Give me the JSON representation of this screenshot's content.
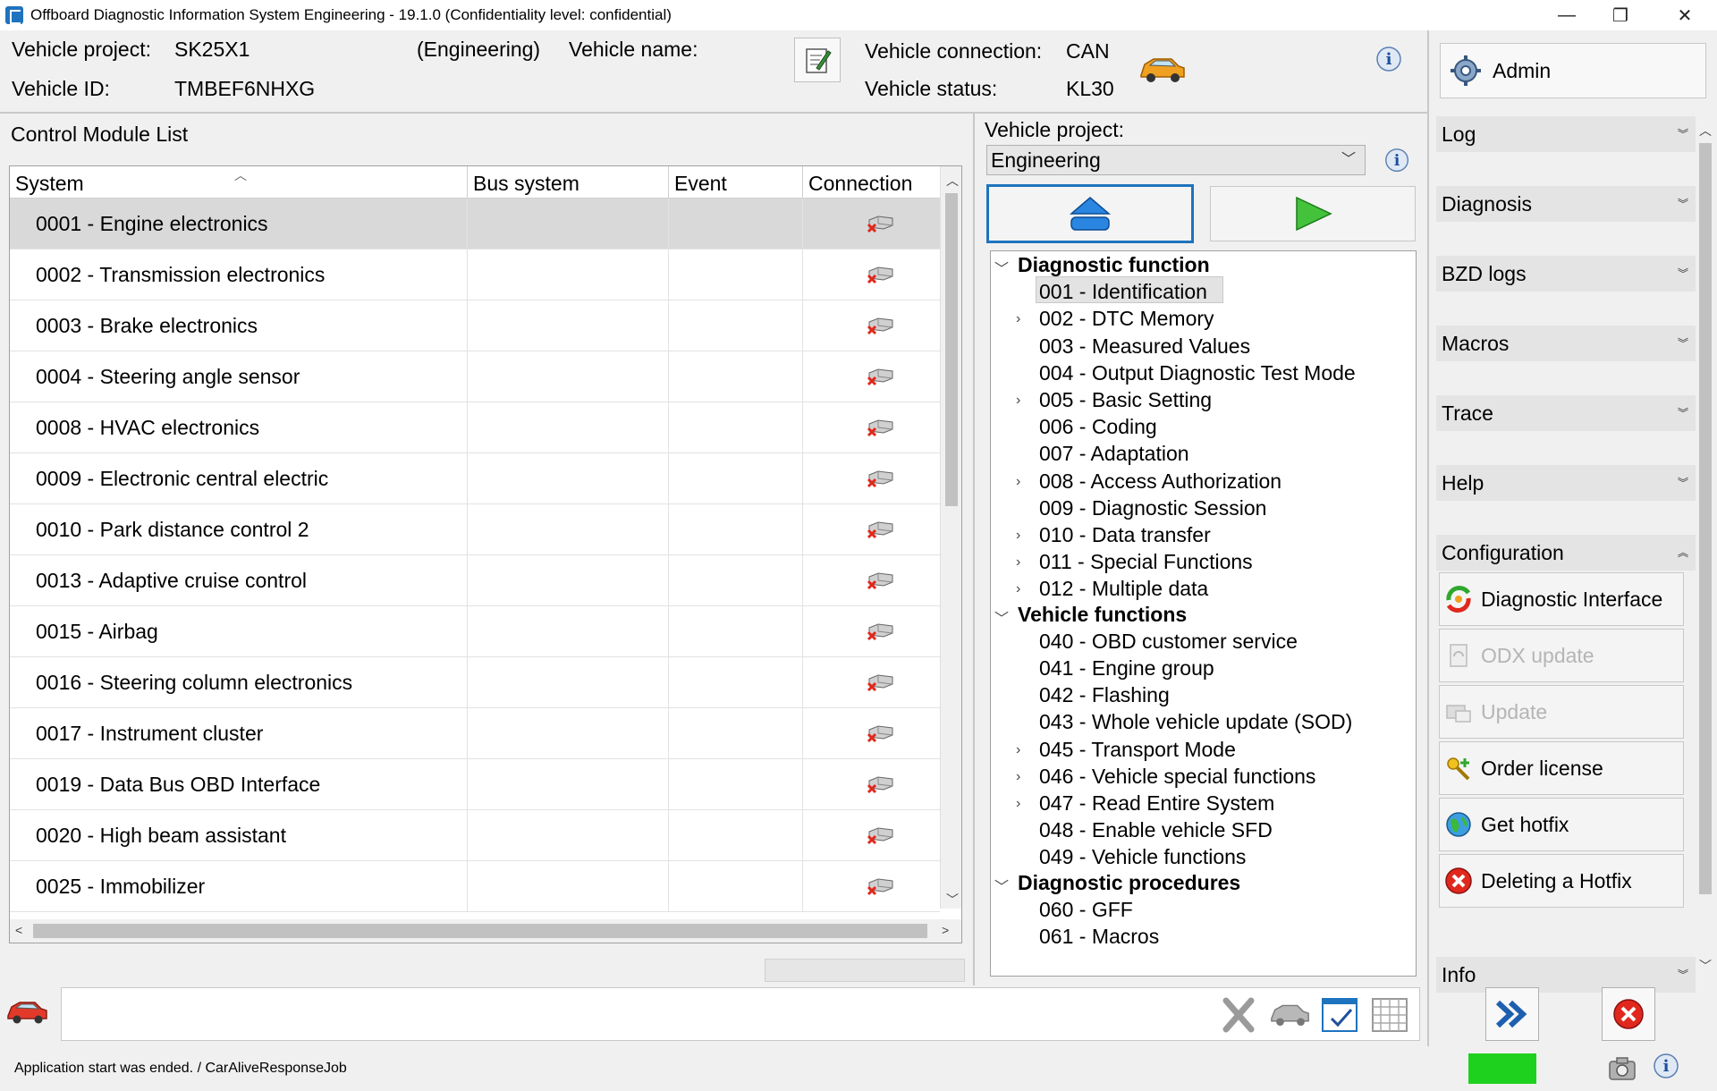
{
  "window": {
    "title": "Offboard Diagnostic Information System Engineering - 19.1.0 (Confidentiality level: confidential)",
    "minimize": "—",
    "restore": "❐",
    "close": "✕"
  },
  "vehicle": {
    "project_label": "Vehicle project:",
    "project_value": "SK25X1",
    "mode": "(Engineering)",
    "name_label": "Vehicle name:",
    "name_value": "",
    "id_label": "Vehicle ID:",
    "id_value": "TMBEF6NHXG",
    "connection_label": "Vehicle connection:",
    "connection_value": "CAN",
    "status_label": "Vehicle status:",
    "status_value": "KL30"
  },
  "admin": {
    "label": "Admin"
  },
  "control_module_list": {
    "title": "Control Module List",
    "columns": [
      "System",
      "Bus system",
      "Event",
      "Connection"
    ],
    "rows": [
      {
        "system": "0001 - Engine electronics",
        "bus": "",
        "event": ""
      },
      {
        "system": "0002 - Transmission electronics",
        "bus": "",
        "event": ""
      },
      {
        "system": "0003 - Brake electronics",
        "bus": "",
        "event": ""
      },
      {
        "system": "0004 - Steering angle sensor",
        "bus": "",
        "event": ""
      },
      {
        "system": "0008 - HVAC electronics",
        "bus": "",
        "event": ""
      },
      {
        "system": "0009 - Electronic central electric",
        "bus": "",
        "event": ""
      },
      {
        "system": "0010 - Park distance control 2",
        "bus": "",
        "event": ""
      },
      {
        "system": "0013 - Adaptive cruise control",
        "bus": "",
        "event": ""
      },
      {
        "system": "0015 - Airbag",
        "bus": "",
        "event": ""
      },
      {
        "system": "0016 - Steering column electronics",
        "bus": "",
        "event": ""
      },
      {
        "system": "0017 - Instrument cluster",
        "bus": "",
        "event": ""
      },
      {
        "system": "0019 - Data Bus OBD Interface",
        "bus": "",
        "event": ""
      },
      {
        "system": "0020 - High beam assistant",
        "bus": "",
        "event": ""
      },
      {
        "system": "0025 - Immobilizer",
        "bus": "",
        "event": ""
      }
    ],
    "selected_index": 0
  },
  "function_panel": {
    "project_label": "Vehicle project:",
    "project_selected": "Engineering"
  },
  "tree": {
    "diag_group": "Diagnostic function",
    "diag_items": [
      "001 - Identification",
      "002 - DTC Memory",
      "003 - Measured Values",
      "004 - Output Diagnostic Test Mode",
      "005 - Basic Setting",
      "006 - Coding",
      "007 - Adaptation",
      "008 - Access Authorization",
      "009 - Diagnostic Session",
      "010 - Data transfer",
      "011 - Special Functions",
      "012 - Multiple data"
    ],
    "veh_group": "Vehicle functions",
    "veh_items": [
      "040 - OBD customer service",
      "041 - Engine group",
      "042 - Flashing",
      "043 - Whole vehicle update (SOD)",
      "045 - Transport Mode",
      "046 - Vehicle special functions",
      "047 - Read Entire System",
      "048 - Enable vehicle SFD",
      "049 - Vehicle functions"
    ],
    "proc_group": "Diagnostic procedures",
    "proc_items": [
      "060 - GFF",
      "061 - Macros"
    ]
  },
  "right_panel": {
    "sections": [
      "Log",
      "Diagnosis",
      "BZD logs",
      "Macros",
      "Trace",
      "Help",
      "Configuration",
      "Info"
    ],
    "config_buttons": [
      {
        "label": "Diagnostic Interface",
        "enabled": true,
        "icon": "diagnostic-interface-icon"
      },
      {
        "label": "ODX update",
        "enabled": false,
        "icon": "odx-update-icon"
      },
      {
        "label": "Update",
        "enabled": false,
        "icon": "update-icon"
      },
      {
        "label": "Order license",
        "enabled": true,
        "icon": "key-plus-icon"
      },
      {
        "label": "Get hotfix",
        "enabled": true,
        "icon": "globe-icon"
      },
      {
        "label": "Deleting a Hotfix",
        "enabled": true,
        "icon": "red-x-icon"
      }
    ]
  },
  "status": {
    "message": "Application start was ended. / CarAliveResponseJob"
  },
  "colors": {
    "accent_blue": "#1e73be",
    "status_green": "#1ed11e",
    "error_red": "#d9261c",
    "car_orange": "#f0a020"
  }
}
